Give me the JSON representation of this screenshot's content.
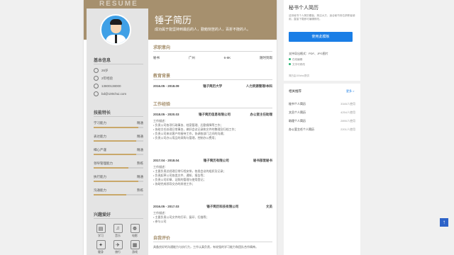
{
  "resume": {
    "watermark": "RESUME",
    "name": "锤子简历",
    "motto": "成功属于能坚持到最后的人，勤勉刻苦的人，百折不挠的人。",
    "sections_left": {
      "basic": "基本信息",
      "skills": "技能特长",
      "hobbies": "兴趣爱好"
    },
    "basic_info": [
      {
        "icon": "person-icon",
        "text": "26岁"
      },
      {
        "icon": "calendar-icon",
        "text": "2年经验"
      },
      {
        "icon": "phone-icon",
        "text": "13800138000"
      },
      {
        "icon": "mail-icon",
        "text": "bd@100chui.com"
      }
    ],
    "skills": [
      {
        "label": "学习能力",
        "level": "精通",
        "fill": 0.9
      },
      {
        "label": "表达能力",
        "level": "精通",
        "fill": 0.85
      },
      {
        "label": "细心严谨",
        "level": "精通",
        "fill": 0.85
      },
      {
        "label": "领导管理能力",
        "level": "熟练",
        "fill": 0.7
      },
      {
        "label": "执行能力",
        "level": "精通",
        "fill": 0.9
      },
      {
        "label": "沟通能力",
        "level": "熟练",
        "fill": 0.65
      }
    ],
    "hobbies": [
      {
        "icon": "book-icon",
        "glyph": "▤",
        "label": "学习"
      },
      {
        "icon": "music-icon",
        "glyph": "♫",
        "label": "音乐"
      },
      {
        "icon": "film-icon",
        "glyph": "❁",
        "label": "电影"
      },
      {
        "icon": "run-icon",
        "glyph": "✦",
        "label": "健身"
      },
      {
        "icon": "travel-icon",
        "glyph": "✈",
        "label": "旅行"
      },
      {
        "icon": "game-icon",
        "glyph": "▦",
        "label": "游戏"
      }
    ],
    "sections_right": {
      "intent": "求职意向",
      "education": "教育背景",
      "work": "工作经验",
      "self": "自我评价"
    },
    "intent": [
      "秘书",
      "广州",
      "6-8K",
      "随时到岗"
    ],
    "education": {
      "date": "2016.05 - 2018.09",
      "school": "锤子简历大学",
      "major": "人力资源管理/本科"
    },
    "work": [
      {
        "date": "2018.05 - 2020.03",
        "company": "锤子简历信息有限公司",
        "role": "办公室主任助理",
        "intro": "工作描述：",
        "lines": [
          "• 负责公司各项行政事务、档案管理、后勤保障等工作；",
          "• 协助主任处理日常事务，做好会议记录和文件的整理及归档工作；",
          "• 负责公司来访客户的接待工作，协调各部门之间的沟通；",
          "• 负责公司办公用品的采购与管理，控制办公费用；"
        ]
      },
      {
        "date": "2017.04 - 2018.04",
        "company": "锤子简历有限公司",
        "role": "秘书部里秘书",
        "intro": "工作描述：",
        "lines": [
          "• 主要负责总经理日常行程安排，各类会议的组织及记录；",
          "• 负责起草公司各类文件、通知、报告等；",
          "• 负责公司印章、证照的管理与使用登记；",
          "• 协助完成领导交办的其他工作；"
        ]
      },
      {
        "date": "2016.05 - 2017.03",
        "company": "锤子简历科技有限公司",
        "role": "文员",
        "intro": "工作描述：",
        "lines": [
          "• 主要负责公司文件的打印、复印、扫描等；",
          "• 参与公司"
        ]
      }
    ],
    "self_eval": "具备良好的沟通能力与执行力，工作认真负责，有较强的学习能力和团队合作精神。"
  },
  "panel": {
    "title": "秘书个人简历",
    "desc": "这份秘书个人简历模板，简洁大方，适合秘书岗位求职者使用，直接下载即可编辑修改。",
    "use_button": "使用此模板",
    "formats": "支持导出格式：PDF、JPG图片",
    "checks": [
      "在线编辑",
      "文字可修改"
    ],
    "note": "简历由100chui提供",
    "hot_title": "相关推荐",
    "hot_more": "更多 >",
    "hot_items": [
      {
        "name": "秘书个人简历",
        "count": "3345人使用"
      },
      {
        "name": "文员个人简历",
        "count": "4254人使用"
      },
      {
        "name": "助理个人简历",
        "count": "2890人使用"
      },
      {
        "name": "办公室主任个人简历",
        "count": "2201人使用"
      }
    ]
  },
  "back_to_top": "↑"
}
